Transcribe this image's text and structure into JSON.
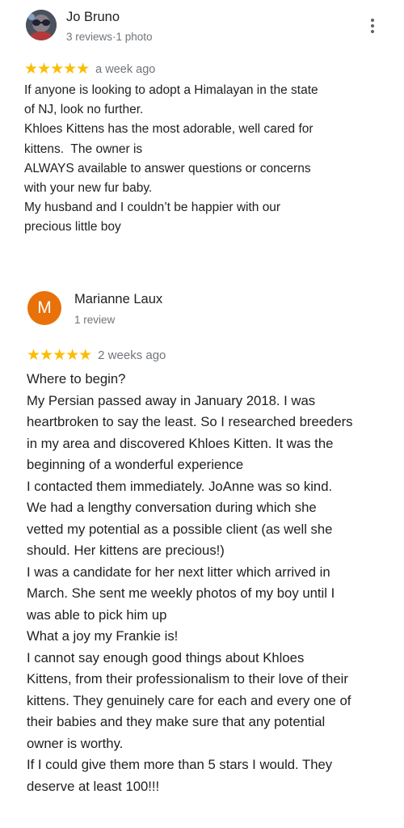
{
  "reviews": [
    {
      "name": "Jo Bruno",
      "meta": "3 reviews·1 photo",
      "avatar_letter": "",
      "stars": "★★★★★",
      "rating": 5,
      "time": "a week ago",
      "text": "If anyone is looking to adopt a Himalayan in the state\nof NJ, look no further.\nKhloes Kittens has the most adorable, well cared for\nkittens.  The owner is\nALWAYS available to answer questions or concerns\nwith your new fur baby.\nMy husband and I couldn’t be happier with our\nprecious little boy"
    },
    {
      "name": "Marianne Laux",
      "meta": "1 review",
      "avatar_letter": "M",
      "stars": "★★★★★",
      "rating": 5,
      "time": "2 weeks ago",
      "text": "Where to begin?\nMy Persian passed away in January 2018. I was\nheartbroken to say the least. So I researched breeders\nin my area and discovered Khloes Kitten. It was the\nbeginning of a wonderful experience\nI contacted them immediately. JoAnne was so kind.\nWe had a lengthy conversation during which she\nvetted my potential as a possible client (as well she\nshould. Her kittens are precious!)\nI was a candidate for her next litter which arrived in\nMarch. She sent me weekly photos of my boy until I\nwas able to pick him up\nWhat a joy my Frankie is!\nI cannot say enough good things about Khloes\nKittens, from their professionalism to their love of their\nkittens. They genuinely care for each and every one of\ntheir babies and they make sure that any potential\nowner is worthy.\nIf I could give them more than 5 stars I would. They\ndeserve at least 100!!!"
    }
  ],
  "colors": {
    "star": "#fbbc04",
    "avatar_orange": "#e8710a",
    "secondary_text": "#70757a"
  },
  "icons": {
    "menu": "more-vert-icon"
  }
}
